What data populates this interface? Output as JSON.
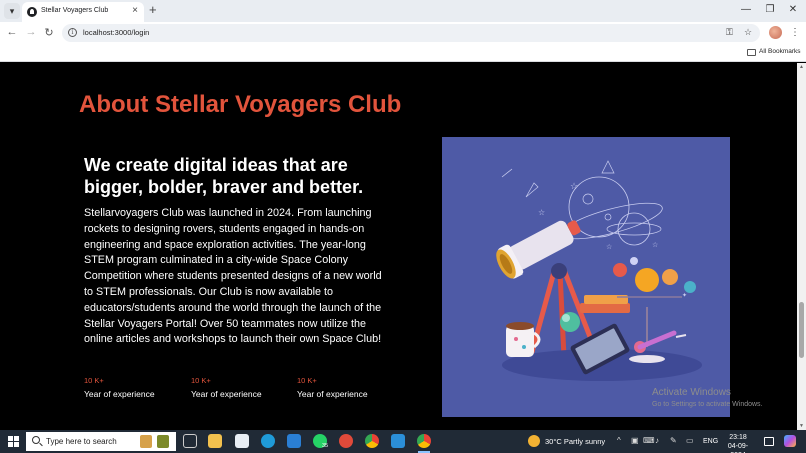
{
  "browser": {
    "tab_title": "Stellar Voyagers Club",
    "url": "localhost:3000/login",
    "bookmarks_label": "All Bookmarks",
    "icons": {
      "tab_menu": "chevron-down-icon",
      "new_tab": "plus-icon",
      "back": "arrow-left-icon",
      "forward": "arrow-right-icon",
      "reload": "refresh-icon",
      "site_info": "info-icon",
      "password": "key-icon",
      "bookmark": "star-icon",
      "menu": "kebab-menu-icon"
    }
  },
  "about": {
    "title": "About Stellar Voyagers Club",
    "headline": "We create digital ideas that are bigger, bolder, braver and better.",
    "body": "Stellarvoyagers Club was launched in 2024. From launching rockets to designing rovers, students engaged in hands-on engineering and space exploration activities. The year-long STEM program culminated in a city-wide Space Colony Competition where students presented designs of a new world to STEM professionals. Our Club is now available to educators/students around the world through the launch of the Stellar Voyagers Portal! Over 50 teammates now utilize the online articles and workshops to launch their own Space Club!",
    "stats": [
      {
        "value": "10 K+",
        "label": "Year of experience"
      },
      {
        "value": "10 K+",
        "label": "Year of experience"
      },
      {
        "value": "10 K+",
        "label": "Year of experience"
      }
    ],
    "accent_color": "#e2543c"
  },
  "watermark": {
    "title": "Activate Windows",
    "subtitle": "Go to Settings to activate Windows."
  },
  "taskbar": {
    "search_placeholder": "Type here to search",
    "whatsapp_badge": "35",
    "weather": "30°C  Partly sunny",
    "language": "ENG",
    "time": "23:18",
    "date": "04-09-2024"
  }
}
